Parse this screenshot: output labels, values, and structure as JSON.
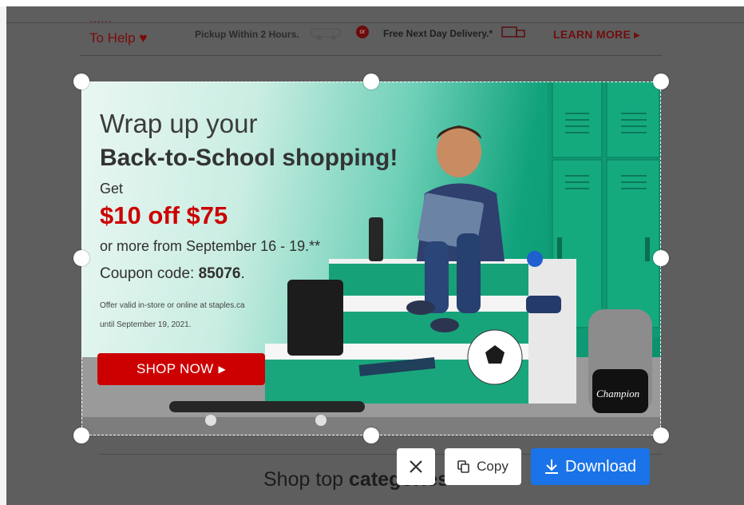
{
  "background_page": {
    "promo_help_text": "To Help",
    "promo_pickup_text": "Pickup Within 2 Hours.",
    "promo_or_badge": "or",
    "promo_delivery_text": "Free Next Day Delivery.*",
    "promo_learn_more": "LEARN MORE ▸",
    "section_title_regular": "Shop top ",
    "section_title_bold": "categories"
  },
  "banner": {
    "headline_line1": "Wrap up your",
    "headline_line2": "Back-to-School shopping!",
    "get_label": "Get",
    "offer": "$10 off $75",
    "date_range": "or more from September 16 - 19.**",
    "coupon_label": "Coupon code: ",
    "coupon_code": "85076",
    "coupon_suffix": ".",
    "fine_print_1": "Offer valid in-store or online at staples.ca",
    "fine_print_2": "until September 19, 2021.",
    "shop_now_label": "SHOP NOW",
    "backpack_brand": "Champion",
    "colors": {
      "accent_red": "#cc0000",
      "locker_green": "#0b8f6b"
    }
  },
  "actions": {
    "close_icon": "close-icon",
    "copy_label": "Copy",
    "download_label": "Download",
    "colors": {
      "download_blue": "#1a73e8"
    }
  }
}
